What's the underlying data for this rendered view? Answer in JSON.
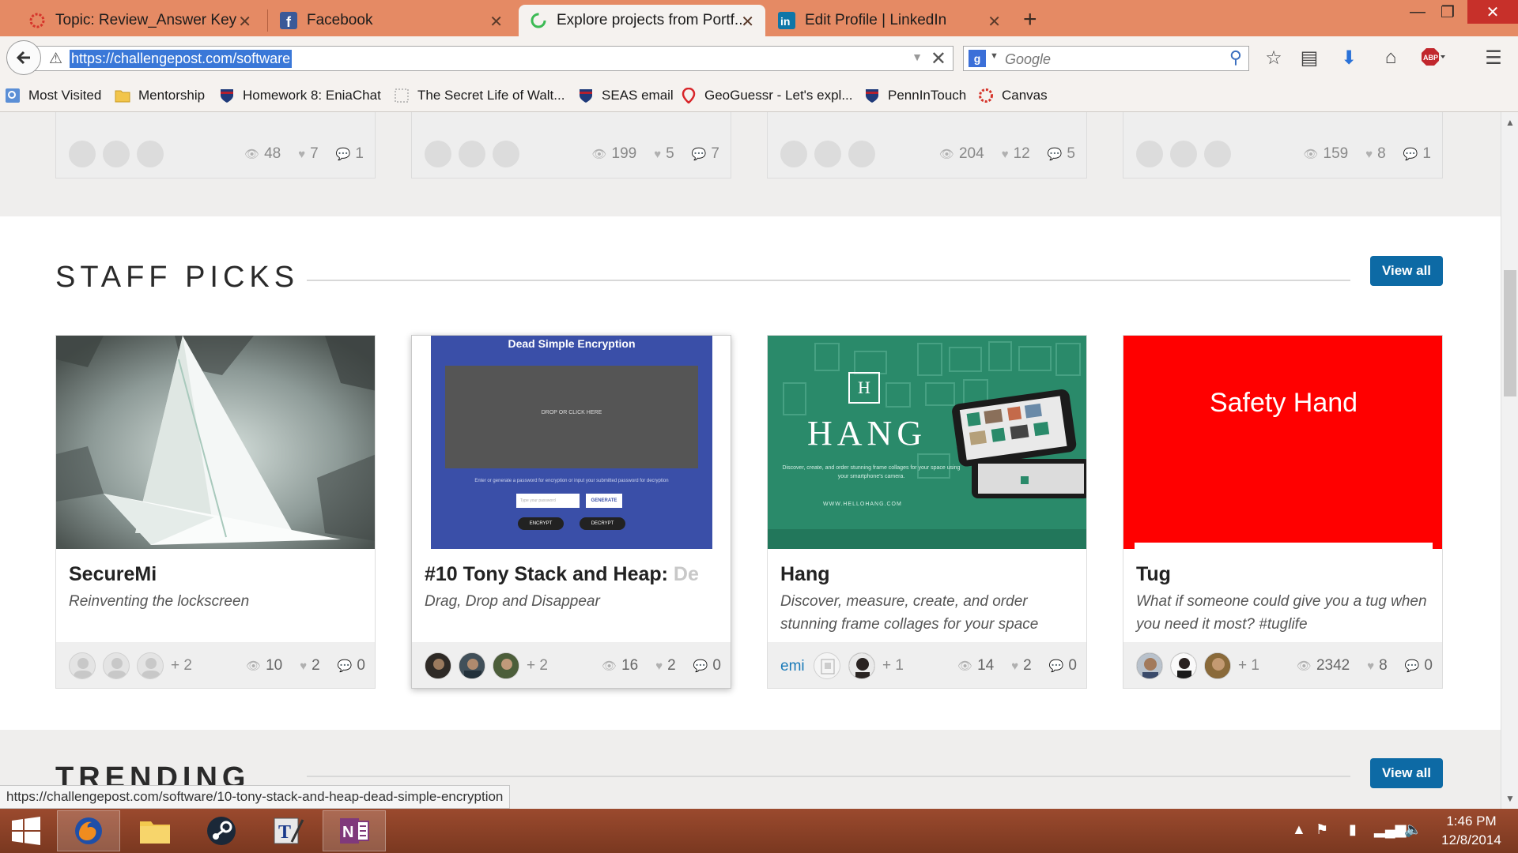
{
  "browser": {
    "tabs": [
      {
        "title": "Topic: Review_Answer Key",
        "icon": "canvas-icon",
        "active": false
      },
      {
        "title": "Facebook",
        "icon": "facebook-icon",
        "active": false
      },
      {
        "title": "Explore projects from Portf...",
        "icon": "loading-spinner-icon",
        "active": true
      },
      {
        "title": "Edit Profile | LinkedIn",
        "icon": "linkedin-icon",
        "active": false
      }
    ],
    "url": "https://challengepost.com/software",
    "search_placeholder": "Google",
    "search_engine_glyph": "g"
  },
  "bookmarks": [
    {
      "label": "Most Visited",
      "icon": "most-visited-icon"
    },
    {
      "label": "Mentorship",
      "icon": "folder-icon"
    },
    {
      "label": "Homework 8: EniaChat",
      "icon": "penn-shield-icon"
    },
    {
      "label": "The Secret Life of Walt...",
      "icon": "blank-page-icon"
    },
    {
      "label": "SEAS email",
      "icon": "penn-shield-icon"
    },
    {
      "label": "GeoGuessr - Let's expl...",
      "icon": "map-pin-icon"
    },
    {
      "label": "PennInTouch",
      "icon": "penn-shield-icon"
    },
    {
      "label": "Canvas",
      "icon": "canvas-icon"
    }
  ],
  "top_row": [
    {
      "views": "48",
      "likes": "7",
      "comments": "1"
    },
    {
      "views": "199",
      "likes": "5",
      "comments": "7"
    },
    {
      "views": "204",
      "likes": "12",
      "comments": "5"
    },
    {
      "views": "159",
      "likes": "8",
      "comments": "1"
    }
  ],
  "staff_picks": {
    "title": "STAFF PICKS",
    "view_all": "View all",
    "cards": [
      {
        "title": "SecureMi",
        "title_fade": "",
        "desc": "Reinventing the lockscreen",
        "extra": "+ 2",
        "views": "10",
        "likes": "2",
        "comments": "0"
      },
      {
        "title": "#10 Tony Stack and Heap: ",
        "title_fade": "De",
        "desc": "Drag, Drop and Disappear",
        "extra": "+ 2",
        "views": "16",
        "likes": "2",
        "comments": "0",
        "thumb": {
          "heading": "Dead Simple Encryption",
          "drop": "DROP OR CLICK HERE",
          "hint": "Enter or generate a password for encryption or input your submitted password for decryption",
          "input_ph": "Type your password",
          "generate": "GENERATE",
          "encrypt": "ENCRYPT",
          "decrypt": "DECRYPT"
        }
      },
      {
        "title": "Hang",
        "title_fade": "",
        "desc": "Discover, measure, create, and order stunning frame collages for your space",
        "extra": "+ 1",
        "owner": "emi",
        "views": "14",
        "likes": "2",
        "comments": "0",
        "thumb": {
          "logo_letter": "H",
          "name": "HANG",
          "tagline": "Discover, create, and order stunning frame collages for your space using your smartphone's camera.",
          "site": "WWW.HELLOHANG.COM"
        }
      },
      {
        "title": "Tug",
        "title_fade": "",
        "desc": "What if someone could give you a tug when you need it most? #tuglife",
        "extra": "+ 1",
        "views": "2342",
        "likes": "8",
        "comments": "0",
        "thumb": {
          "heading": "Safety Hand"
        }
      }
    ]
  },
  "trending": {
    "title": "TRENDING",
    "view_all": "View all"
  },
  "status_url": "https://challengepost.com/software/10-tony-stack-and-heap-dead-simple-encryption",
  "clock": {
    "time": "1:46 PM",
    "date": "12/8/2014"
  },
  "colors": {
    "tabstrip": "#e58a64",
    "accent": "#0d6aa5",
    "tug_red": "#ff0000",
    "hang_green": "#2a8a6a",
    "encryption_blue": "#3a4fa8"
  }
}
